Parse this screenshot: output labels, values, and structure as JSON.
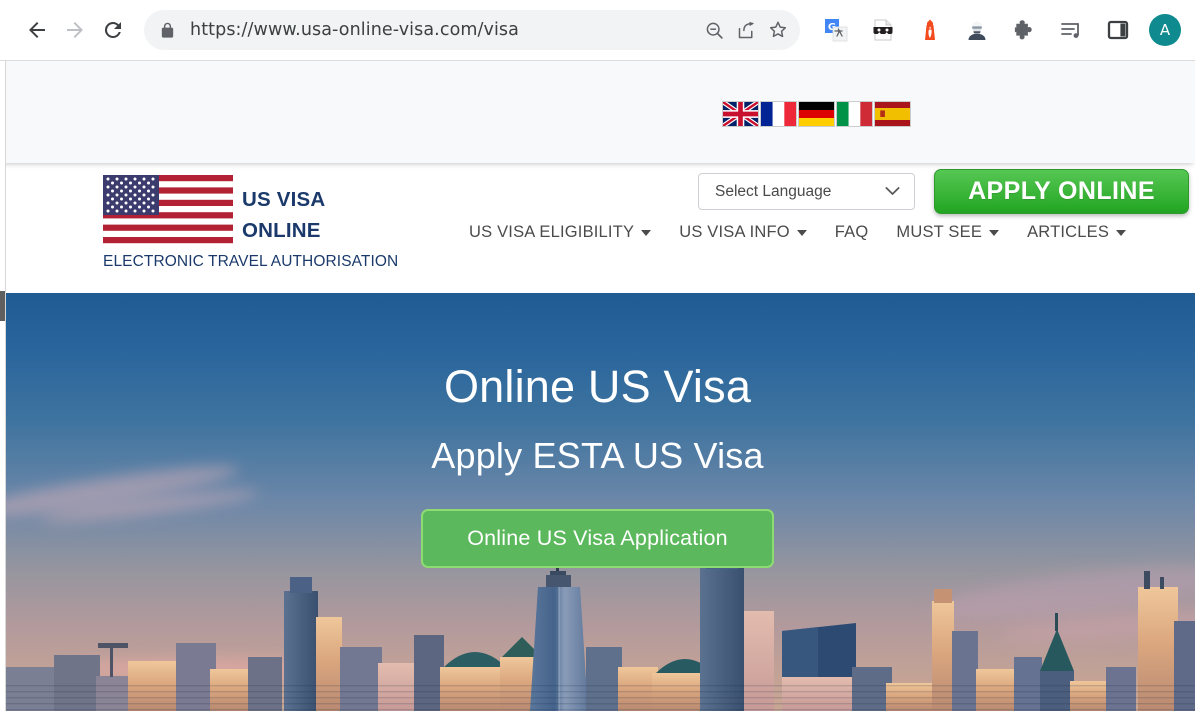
{
  "browser": {
    "back_icon": "arrow-left",
    "forward_icon": "arrow-right",
    "reload_icon": "reload",
    "lock_icon": "padlock",
    "url": "https://www.usa-online-visa.com/visa",
    "omnibox_actions": [
      "zoom-out-icon",
      "share-icon",
      "bookmark-star-icon"
    ],
    "extensions": [
      "google-translate-icon",
      "masked-document-icon",
      "lighthouse-icon",
      "avatar-person-icon",
      "puzzle-extensions-icon",
      "reading-list-music-icon",
      "side-panel-icon"
    ],
    "profile_initial": "A",
    "profile_color": "#0f8b8f"
  },
  "utility_bar": {
    "flags": [
      {
        "name": "flag-uk",
        "label": "English"
      },
      {
        "name": "flag-france",
        "label": "Français"
      },
      {
        "name": "flag-germany",
        "label": "Deutsch"
      },
      {
        "name": "flag-italy",
        "label": "Italiano"
      },
      {
        "name": "flag-spain",
        "label": "Español"
      }
    ],
    "language_select": {
      "value": "Select Language",
      "chevron": "chevron-down-icon"
    },
    "apply_button": "APPLY ONLINE",
    "apply_button_color": "#3fb83d"
  },
  "header": {
    "brand": {
      "line1": "US VISA",
      "line2": "ONLINE",
      "subtitle": "ELECTRONIC TRAVEL AUTHORISATION",
      "flag_icon": "us-flag-icon",
      "brand_color": "#1b3a6b"
    },
    "nav": [
      {
        "label": "US VISA ELIGIBILITY",
        "dropdown": true
      },
      {
        "label": "US VISA INFO",
        "dropdown": true
      },
      {
        "label": "FAQ",
        "dropdown": false
      },
      {
        "label": "MUST SEE",
        "dropdown": true
      },
      {
        "label": "ARTICLES",
        "dropdown": true
      }
    ]
  },
  "hero": {
    "title": "Online US Visa",
    "subtitle": "Apply ESTA US Visa",
    "cta": "Online US Visa Application",
    "cta_color": "#5cb85c",
    "background": "new-york-skyline-one-world-trade-center-at-dusk"
  }
}
